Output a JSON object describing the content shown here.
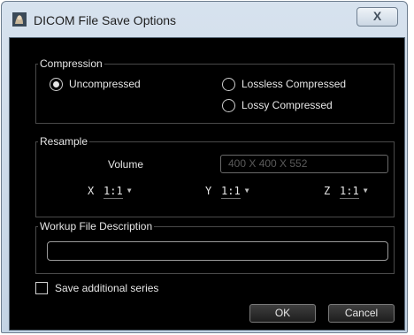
{
  "window": {
    "title": "DICOM File Save Options",
    "close_glyph": "X",
    "icon": "dicom-app-icon"
  },
  "compression": {
    "label": "Compression",
    "options": [
      {
        "label": "Uncompressed",
        "selected": true
      },
      {
        "label": "Lossless Compressed",
        "selected": false
      },
      {
        "label": "Lossy Compressed",
        "selected": false
      }
    ]
  },
  "resample": {
    "label": "Resample",
    "volume_label": "Volume",
    "volume_value": "400 X 400 X 552",
    "axes": [
      {
        "axis": "X",
        "value": "1:1"
      },
      {
        "axis": "Y",
        "value": "1:1"
      },
      {
        "axis": "Z",
        "value": "1:1"
      }
    ]
  },
  "workup": {
    "label": "Workup File Description",
    "value": ""
  },
  "save_additional": {
    "label": "Save additional series",
    "checked": false
  },
  "buttons": {
    "ok": "OK",
    "cancel": "Cancel"
  },
  "colors": {
    "client_bg": "#000000",
    "text": "#e6e6e6",
    "titlebar": "#c3d3e4"
  }
}
